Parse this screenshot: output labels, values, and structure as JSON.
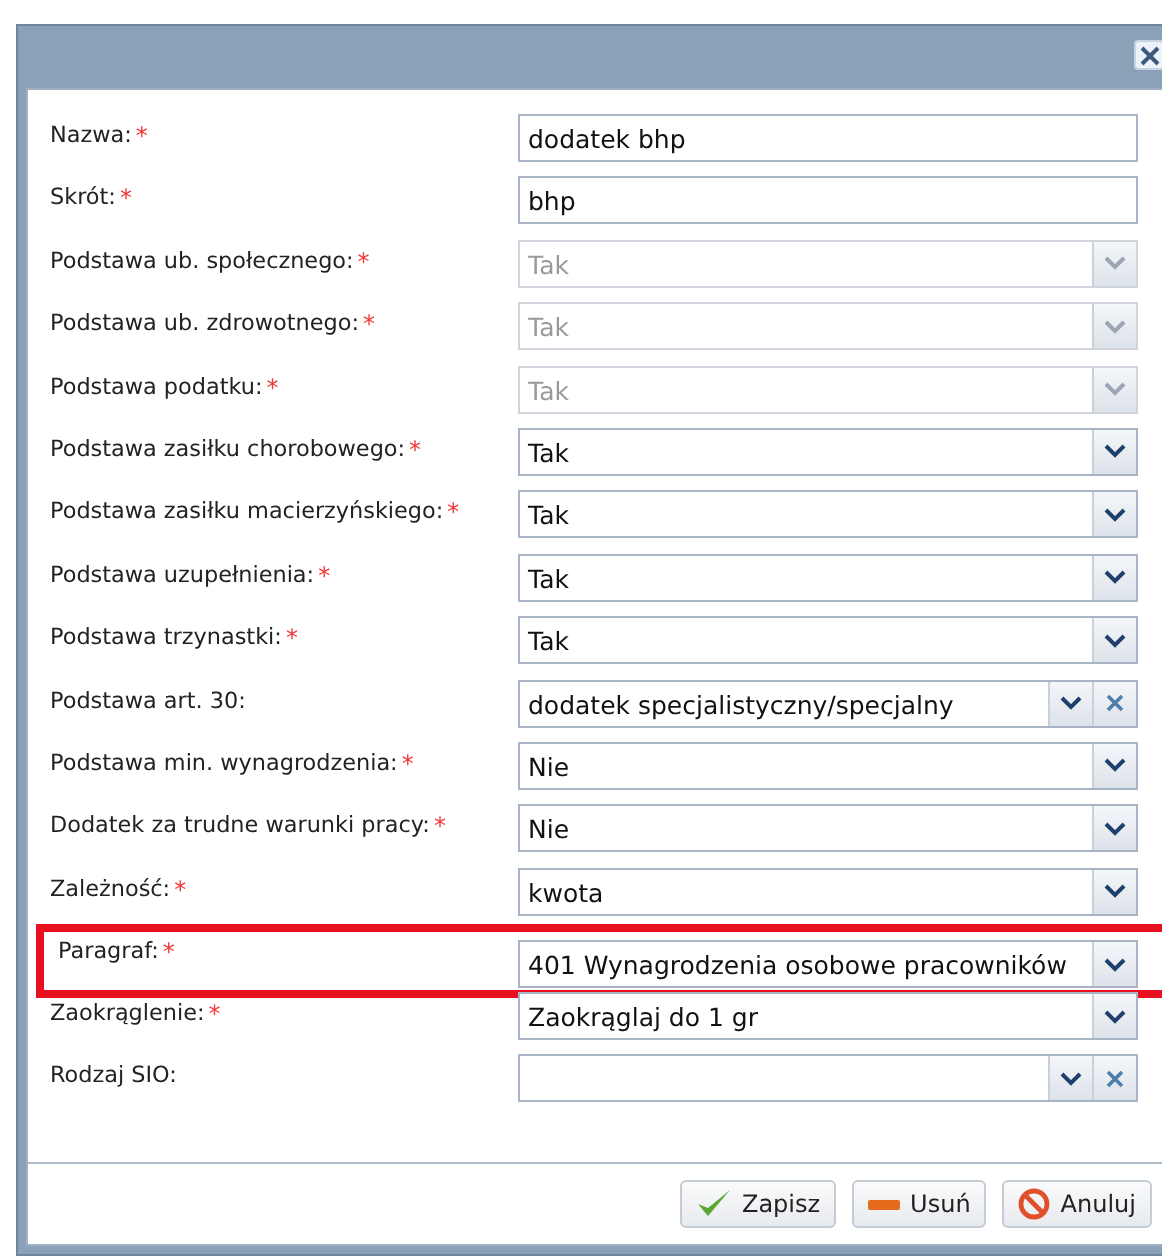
{
  "fields": [
    {
      "label": "Nazwa:",
      "mark": "*",
      "kind": "text",
      "value": "dodatek bhp",
      "disabled": false,
      "highlighted": false
    },
    {
      "label": "Skrót:",
      "mark": "*",
      "kind": "text",
      "value": "bhp",
      "disabled": false,
      "highlighted": false
    },
    {
      "label": "Podstawa ub. społecznego:",
      "mark": "*",
      "kind": "combo",
      "value": "Tak",
      "disabled": true,
      "highlighted": false
    },
    {
      "label": "Podstawa ub. zdrowotnego:",
      "mark": "*",
      "kind": "combo",
      "value": "Tak",
      "disabled": true,
      "highlighted": false
    },
    {
      "label": "Podstawa podatku:",
      "mark": "*",
      "kind": "combo",
      "value": "Tak",
      "disabled": true,
      "highlighted": false
    },
    {
      "label": "Podstawa zasiłku chorobowego:",
      "mark": "*",
      "kind": "combo",
      "value": "Tak",
      "disabled": false,
      "highlighted": false
    },
    {
      "label": "Podstawa zasiłku macierzyńskiego:",
      "mark": "*",
      "kind": "combo",
      "value": "Tak",
      "disabled": false,
      "highlighted": false
    },
    {
      "label": "Podstawa uzupełnienia:",
      "mark": "*",
      "kind": "combo",
      "value": "Tak",
      "disabled": false,
      "highlighted": false
    },
    {
      "label": "Podstawa trzynastki:",
      "mark": "*",
      "kind": "combo",
      "value": "Tak",
      "disabled": false,
      "highlighted": false
    },
    {
      "label": "Podstawa art. 30:",
      "kind": "combo-clear",
      "value": "dodatek specjalistyczny/specjalny",
      "disabled": false,
      "highlighted": false
    },
    {
      "label": "Podstawa min. wynagrodzenia:",
      "mark": "*",
      "kind": "combo",
      "value": "Nie",
      "disabled": false,
      "highlighted": false
    },
    {
      "label": "Dodatek za trudne warunki pracy:",
      "mark": "*",
      "kind": "combo",
      "value": "Nie",
      "disabled": false,
      "highlighted": false
    },
    {
      "label": "Zależność:",
      "mark": "*",
      "kind": "combo",
      "value": "kwota",
      "disabled": false,
      "highlighted": false
    },
    {
      "label": "Paragraf:",
      "mark": "*",
      "kind": "combo",
      "value": "401 Wynagrodzenia osobowe pracowników",
      "disabled": false,
      "highlighted": true
    },
    {
      "label": "Zaokrąglenie:",
      "mark": "*",
      "kind": "combo",
      "value": "Zaokrąglaj do 1 gr",
      "disabled": false,
      "highlighted": false
    },
    {
      "label": "Rodzaj SIO:",
      "kind": "combo-clear",
      "disabled": false,
      "highlighted": false
    }
  ],
  "buttons": [
    {
      "label": "Zapisz",
      "kind": "save"
    },
    {
      "label": "Usuń",
      "kind": "delete"
    },
    {
      "label": "Anuluj",
      "kind": "cancel"
    }
  ]
}
